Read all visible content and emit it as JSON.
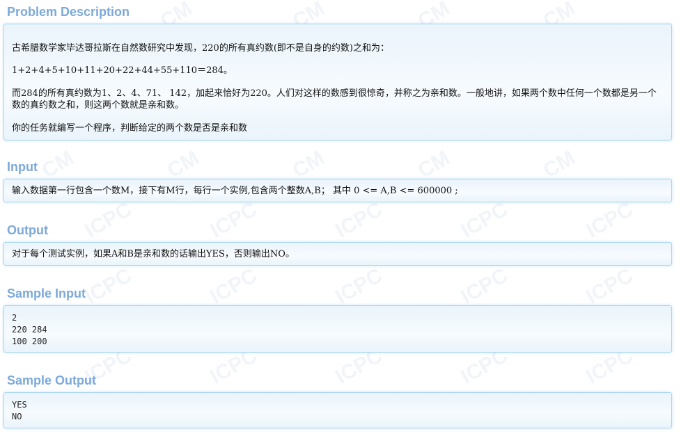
{
  "sections": {
    "description": {
      "title": "Problem Description",
      "p1": "古希腊数学家毕达哥拉斯在自然数研究中发现，220的所有真约数(即不是自身的约数)之和为：",
      "p2": "1+2+4+5+10+11+20+22+44+55+110＝284。",
      "p3": "而284的所有真约数为1、2、4、71、 142，加起来恰好为220。人们对这样的数感到很惊奇，并称之为亲和数。一般地讲，如果两个数中任何一个数都是另一个数的真约数之和，则这两个数就是亲和数。",
      "p4": "你的任务就编写一个程序，判断给定的两个数是否是亲和数"
    },
    "input": {
      "title": "Input",
      "text": "输入数据第一行包含一个数M，接下有M行，每行一个实例,包含两个整数A,B； 其中 0 <= A,B <= 600000 ;"
    },
    "output": {
      "title": "Output",
      "text": "对于每个测试实例，如果A和B是亲和数的话输出YES，否则输出NO。"
    },
    "sample_input": {
      "title": "Sample Input",
      "lines": [
        "2",
        "220 284",
        "100 200"
      ]
    },
    "sample_output": {
      "title": "Sample Output",
      "lines": [
        "YES",
        "NO"
      ]
    }
  }
}
